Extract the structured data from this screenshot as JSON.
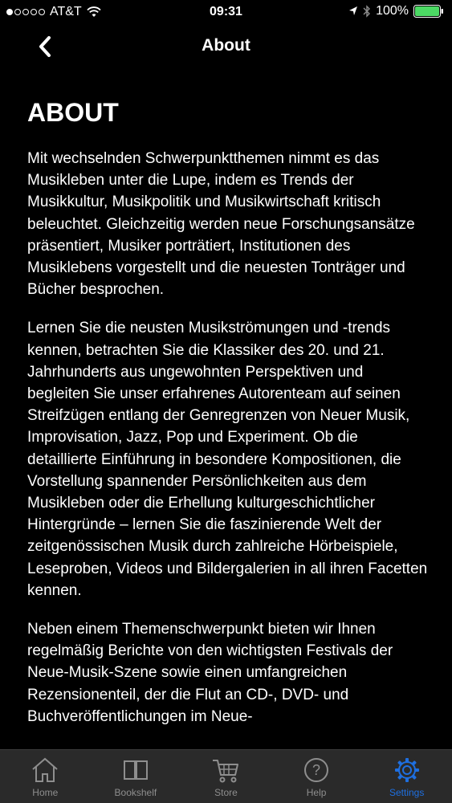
{
  "status_bar": {
    "carrier": "AT&T",
    "time": "09:31",
    "battery": "100%"
  },
  "nav": {
    "title": "About",
    "back_label": "❮"
  },
  "content": {
    "heading": "ABOUT",
    "paragraphs": [
      "Mit wechselnden Schwerpunktthemen nimmt es das Musikleben unter die Lupe, indem es Trends der Musikkultur, Musikpolitik und Musikwirtschaft kritisch beleuchtet. Gleichzeitig werden neue Forschungsansätze präsentiert, Musiker porträtiert, Institutionen des Musiklebens vorgestellt und die neuesten Tonträger und Bücher besprochen.",
      "Lernen Sie die neusten Musikströmungen und -trends kennen, betrachten Sie die Klassiker des 20. und 21. Jahrhunderts aus ungewohnten Perspektiven und begleiten Sie unser erfahrenes Autorenteam auf seinen Streifzügen entlang der Genregrenzen von Neuer Musik, Improvisation, Jazz, Pop und Experiment. Ob die detaillierte Einführung in besondere Kompositionen, die Vorstellung spannender Persönlichkeiten aus dem Musikleben oder die Erhellung kulturgeschichtlicher Hintergründe – lernen Sie die faszinierende Welt der zeitgenössischen Musik durch zahlreiche Hörbeispiele, Leseproben, Videos und Bildergalerien in all ihren Facetten kennen.",
      "Neben einem Themenschwerpunkt bieten wir Ihnen regelmäßig Berichte von den wichtigsten Festivals der Neue-Musik-Szene sowie einen umfangreichen Rezensionenteil, der die Flut an CD-, DVD- und Buchveröffentlichungen im Neue-"
    ]
  },
  "tab_bar": {
    "items": [
      {
        "label": "Home",
        "icon": "home-icon"
      },
      {
        "label": "Bookshelf",
        "icon": "book-icon"
      },
      {
        "label": "Store",
        "icon": "cart-icon"
      },
      {
        "label": "Help",
        "icon": "help-icon"
      },
      {
        "label": "Settings",
        "icon": "gear-icon"
      }
    ],
    "active": "Settings"
  },
  "colors": {
    "background": "#000000",
    "text": "#ffffff",
    "tab_bar_bg": "#2a2a2a",
    "tab_inactive": "#8e8e8e",
    "tab_active": "#1e6fe0",
    "battery_green": "#4cd964"
  }
}
